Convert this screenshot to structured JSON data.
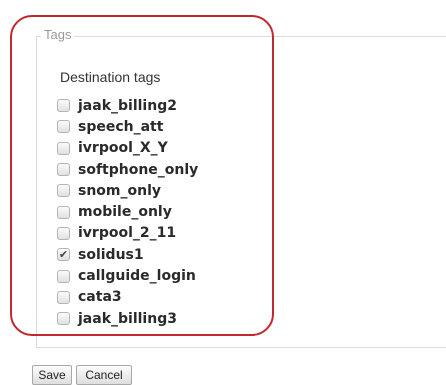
{
  "fieldset": {
    "legend": "Tags"
  },
  "destination_tags": {
    "label": "Destination tags",
    "items": [
      {
        "label": "jaak_billing2",
        "checked": false
      },
      {
        "label": "speech_att",
        "checked": false
      },
      {
        "label": "ivrpool_X_Y",
        "checked": false
      },
      {
        "label": "softphone_only",
        "checked": false
      },
      {
        "label": "snom_only",
        "checked": false
      },
      {
        "label": "mobile_only",
        "checked": false
      },
      {
        "label": "ivrpool_2_11",
        "checked": false
      },
      {
        "label": "solidus1",
        "checked": true
      },
      {
        "label": "callguide_login",
        "checked": false
      },
      {
        "label": "cata3",
        "checked": false
      },
      {
        "label": "jaak_billing3",
        "checked": false
      }
    ]
  },
  "buttons": {
    "save": "Save",
    "cancel": "Cancel"
  },
  "colors": {
    "highlight": "#c0282d",
    "checkmark": "#444444"
  }
}
